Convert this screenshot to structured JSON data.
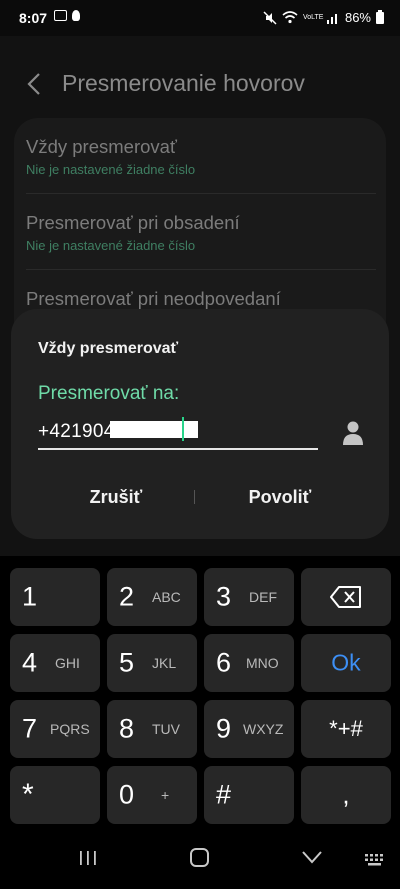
{
  "status_bar": {
    "time": "8:07",
    "battery": "86%",
    "network_small": "VoLTE",
    "icons": [
      "image-icon",
      "bulb-icon",
      "mute-icon",
      "wifi-icon",
      "signal-icon",
      "battery-icon"
    ]
  },
  "header": {
    "title": "Presmerovanie hovorov"
  },
  "settings": {
    "items": [
      {
        "title": "Vždy presmerovať",
        "subtitle": "Nie je nastavené žiadne číslo"
      },
      {
        "title": "Presmerovať pri obsadení",
        "subtitle": "Nie je nastavené žiadne číslo"
      },
      {
        "title": "Presmerovať pri neodpovedaní",
        "subtitle": ""
      }
    ]
  },
  "dialog": {
    "title": "Vždy presmerovať",
    "field_label": "Presmerovať na:",
    "number_value": "+421904",
    "cancel_label": "Zrušiť",
    "confirm_label": "Povoliť"
  },
  "keypad": {
    "rows": [
      [
        {
          "main": "1",
          "sub": ""
        },
        {
          "main": "2",
          "sub": "ABC"
        },
        {
          "main": "3",
          "sub": "DEF"
        },
        {
          "main": "⌫",
          "sub": ""
        }
      ],
      [
        {
          "main": "4",
          "sub": "GHI"
        },
        {
          "main": "5",
          "sub": "JKL"
        },
        {
          "main": "6",
          "sub": "MNO"
        },
        {
          "main": "Ok",
          "sub": ""
        }
      ],
      [
        {
          "main": "7",
          "sub": "PQRS"
        },
        {
          "main": "8",
          "sub": "TUV"
        },
        {
          "main": "9",
          "sub": "WXYZ"
        },
        {
          "main": "*+#",
          "sub": ""
        }
      ],
      [
        {
          "main": "*",
          "sub": ""
        },
        {
          "main": "0",
          "sub": "+"
        },
        {
          "main": "#",
          "sub": ""
        },
        {
          "main": ",",
          "sub": ""
        }
      ]
    ],
    "accent_color": "#3d8ff5"
  },
  "colors": {
    "accent_green": "#6fdba8",
    "dialog_bg": "#212121",
    "key_bg": "#272727"
  }
}
